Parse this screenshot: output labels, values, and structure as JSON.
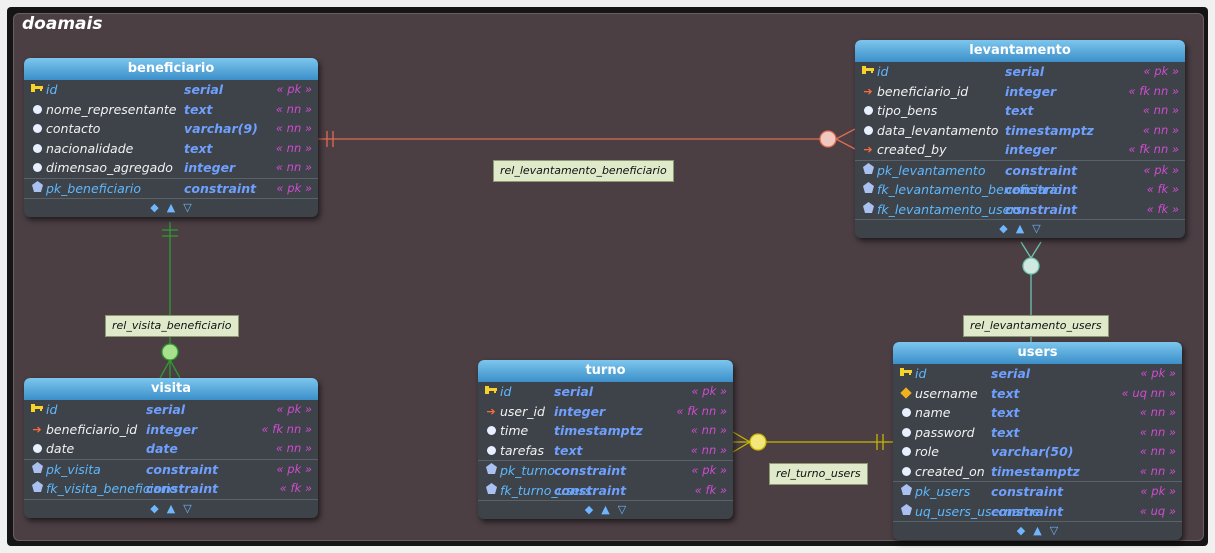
{
  "schema_name": "doamais",
  "icons": {
    "pk": "key-icon",
    "fk": "arrow-right-icon",
    "field": "circle-icon",
    "unique": "diamond-icon",
    "constraint": "constraint-icon"
  },
  "colors": {
    "header": "#3c8fc9",
    "pk_text": "#5eb8ff",
    "type_text": "#6fa0ff",
    "constraint_text": "#d14bd1",
    "fk_icon": "#ff6b3a",
    "key_icon": "#f6d22b",
    "rel_beneficiario": "#e06a52",
    "rel_visita": "#2f9a36",
    "rel_users": "#6fc3b0",
    "rel_turno": "#c7b600"
  },
  "footer_icons": [
    "◆",
    "▲",
    "▽"
  ],
  "tables": {
    "beneficiario": {
      "title": "beneficiario",
      "fields": [
        {
          "icon": "pk",
          "name": "id",
          "type": "serial",
          "con": "« pk »"
        },
        {
          "icon": "field",
          "name": "nome_representante",
          "type": "text",
          "con": "« nn »"
        },
        {
          "icon": "field",
          "name": "contacto",
          "type": "varchar(9)",
          "con": "« nn »"
        },
        {
          "icon": "field",
          "name": "nacionalidade",
          "type": "text",
          "con": "« nn »"
        },
        {
          "icon": "field",
          "name": "dimensao_agregado",
          "type": "integer",
          "con": "« nn »"
        }
      ],
      "constraints": [
        {
          "name": "pk_beneficiario",
          "type": "constraint",
          "con": "« pk »"
        }
      ]
    },
    "levantamento": {
      "title": "levantamento",
      "fields": [
        {
          "icon": "pk",
          "name": "id",
          "type": "serial",
          "con": "« pk »"
        },
        {
          "icon": "fk",
          "name": "beneficiario_id",
          "type": "integer",
          "con": "« fk nn »"
        },
        {
          "icon": "field",
          "name": "tipo_bens",
          "type": "text",
          "con": "« nn »"
        },
        {
          "icon": "field",
          "name": "data_levantamento",
          "type": "timestamptz",
          "con": "« nn »"
        },
        {
          "icon": "fk",
          "name": "created_by",
          "type": "integer",
          "con": "« fk nn »"
        }
      ],
      "constraints": [
        {
          "name": "pk_levantamento",
          "type": "constraint",
          "con": "« pk »"
        },
        {
          "name": "fk_levantamento_beneficiario",
          "type": "constraint",
          "con": "« fk »"
        },
        {
          "name": "fk_levantamento_users",
          "type": "constraint",
          "con": "« fk »"
        }
      ]
    },
    "visita": {
      "title": "visita",
      "fields": [
        {
          "icon": "pk",
          "name": "id",
          "type": "serial",
          "con": "« pk »"
        },
        {
          "icon": "fk",
          "name": "beneficiario_id",
          "type": "integer",
          "con": "« fk nn »"
        },
        {
          "icon": "field",
          "name": "date",
          "type": "date",
          "con": "« nn »"
        }
      ],
      "constraints": [
        {
          "name": "pk_visita",
          "type": "constraint",
          "con": "« pk »"
        },
        {
          "name": "fk_visita_beneficiario",
          "type": "constraint",
          "con": "« fk »"
        }
      ]
    },
    "turno": {
      "title": "turno",
      "fields": [
        {
          "icon": "pk",
          "name": "id",
          "type": "serial",
          "con": "« pk »"
        },
        {
          "icon": "fk",
          "name": "user_id",
          "type": "integer",
          "con": "« fk nn »"
        },
        {
          "icon": "field",
          "name": "time",
          "type": "timestamptz",
          "con": "« nn »"
        },
        {
          "icon": "field",
          "name": "tarefas",
          "type": "text",
          "con": "« nn »"
        }
      ],
      "constraints": [
        {
          "name": "pk_turno",
          "type": "constraint",
          "con": "« pk »"
        },
        {
          "name": "fk_turno_users",
          "type": "constraint",
          "con": "« fk »"
        }
      ]
    },
    "users": {
      "title": "users",
      "fields": [
        {
          "icon": "pk",
          "name": "id",
          "type": "serial",
          "con": "« pk »"
        },
        {
          "icon": "unique",
          "name": "username",
          "type": "text",
          "con": "« uq nn »"
        },
        {
          "icon": "field",
          "name": "name",
          "type": "text",
          "con": "« nn »"
        },
        {
          "icon": "field",
          "name": "password",
          "type": "text",
          "con": "« nn »"
        },
        {
          "icon": "field",
          "name": "role",
          "type": "varchar(50)",
          "con": "« nn »"
        },
        {
          "icon": "field",
          "name": "created_on",
          "type": "timestamptz",
          "con": "« nn »"
        }
      ],
      "constraints": [
        {
          "name": "pk_users",
          "type": "constraint",
          "con": "« pk »"
        },
        {
          "name": "uq_users_username",
          "type": "constraint",
          "con": "« uq »"
        }
      ]
    }
  },
  "relationships": {
    "levantamento_beneficiario": "rel_levantamento_beneficiario",
    "visita_beneficiario": "rel_visita_beneficiario",
    "levantamento_users": "rel_levantamento_users",
    "turno_users": "rel_turno_users"
  }
}
